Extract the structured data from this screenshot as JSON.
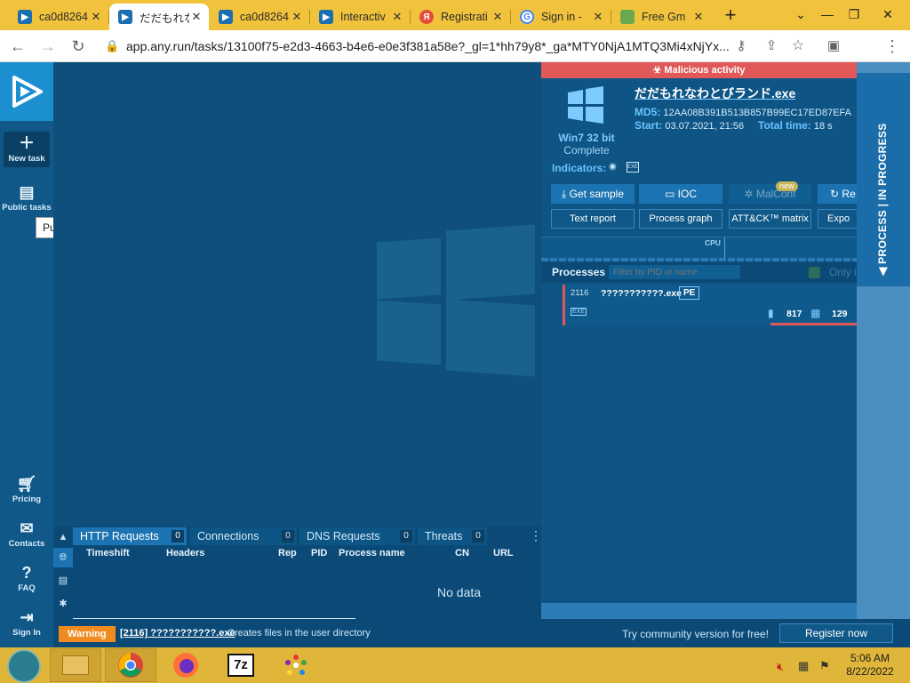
{
  "browser": {
    "tabs": [
      {
        "title": "ca0d8264",
        "color": "#1b6fb0"
      },
      {
        "title": "だだもれな",
        "color": "#1b6fb0"
      },
      {
        "title": "ca0d8264",
        "color": "#1b6fb0"
      },
      {
        "title": "Interactiv",
        "color": "#1b6fb0"
      },
      {
        "title": "Registrati",
        "color": "#e44d3a"
      },
      {
        "title": "Sign in -",
        "color": "#4285f4"
      },
      {
        "title": "Free Gm",
        "color": "#6aa84f"
      }
    ],
    "active_tab_index": 1,
    "url": "app.any.run/tasks/13100f75-e2d3-4663-b4e6-e0e3f381a58e?_gl=1*hh79y8*_ga*MTY0NjA1MTQ3Mi4xNjYx..."
  },
  "leftnav": {
    "items": [
      {
        "label": "New task",
        "icon": "plus-icon"
      },
      {
        "label": "Public tasks",
        "icon": "document-icon"
      },
      {
        "label": "Pricing",
        "icon": "cart-icon"
      },
      {
        "label": "Contacts",
        "icon": "mail-icon"
      },
      {
        "label": "FAQ",
        "icon": "help-icon"
      },
      {
        "label": "Sign In",
        "icon": "signin-icon"
      }
    ],
    "tooltip": "Public submissions"
  },
  "task": {
    "banner": "Malicious activity",
    "file_name": "だだもれなわとびランド.exe",
    "os": "Win7 32 bit",
    "status": "Complete",
    "md5_label": "MD5:",
    "md5": "12AA08B391B513B857B99EC17ED87EFA",
    "start_label": "Start:",
    "start": "03.07.2021, 21:56",
    "total_label": "Total time:",
    "total": "18 s",
    "indicators_label": "Indicators:",
    "buttons": {
      "get_sample": "Get sample",
      "ioc": "IOC",
      "malconf": "MalConf",
      "malconf_badge": "new",
      "restart": "Re",
      "text_report": "Text report",
      "process_graph": "Process graph",
      "attck": "ATT&CK™ matrix",
      "export": "Expo"
    },
    "cpu_label": "CPU",
    "processes_title": "Processes",
    "filter_placeholder": "Filter by PID or name",
    "only_label": "Only i",
    "process": {
      "pid": "2116",
      "name": "???????????.exe",
      "type": "PE",
      "exe_tag": "EXE",
      "files": "817",
      "registry": "129"
    },
    "side_label": "PROCESS | IN PROGRESS"
  },
  "bottom_tabs": {
    "tabs": [
      {
        "label": "HTTP Requests",
        "count": "0"
      },
      {
        "label": "Connections",
        "count": "0"
      },
      {
        "label": "DNS Requests",
        "count": "0"
      },
      {
        "label": "Threats",
        "count": "0"
      }
    ],
    "columns": [
      "Timeshift",
      "Headers",
      "Rep",
      "PID",
      "Process name",
      "CN",
      "URL"
    ],
    "empty": "No data"
  },
  "warning": {
    "badge": "Warning",
    "process": "[2116] ???????????.exe",
    "message": "Creates files in the user directory",
    "community": "Try community version for free!",
    "register": "Register now"
  },
  "taskbar": {
    "time": "5:06 AM",
    "date": "8/22/2022"
  },
  "colors": {
    "accent": "#1b8fd0",
    "malicious": "#e05858",
    "warning": "#f08c1f",
    "taskbar": "#e0b63a"
  }
}
